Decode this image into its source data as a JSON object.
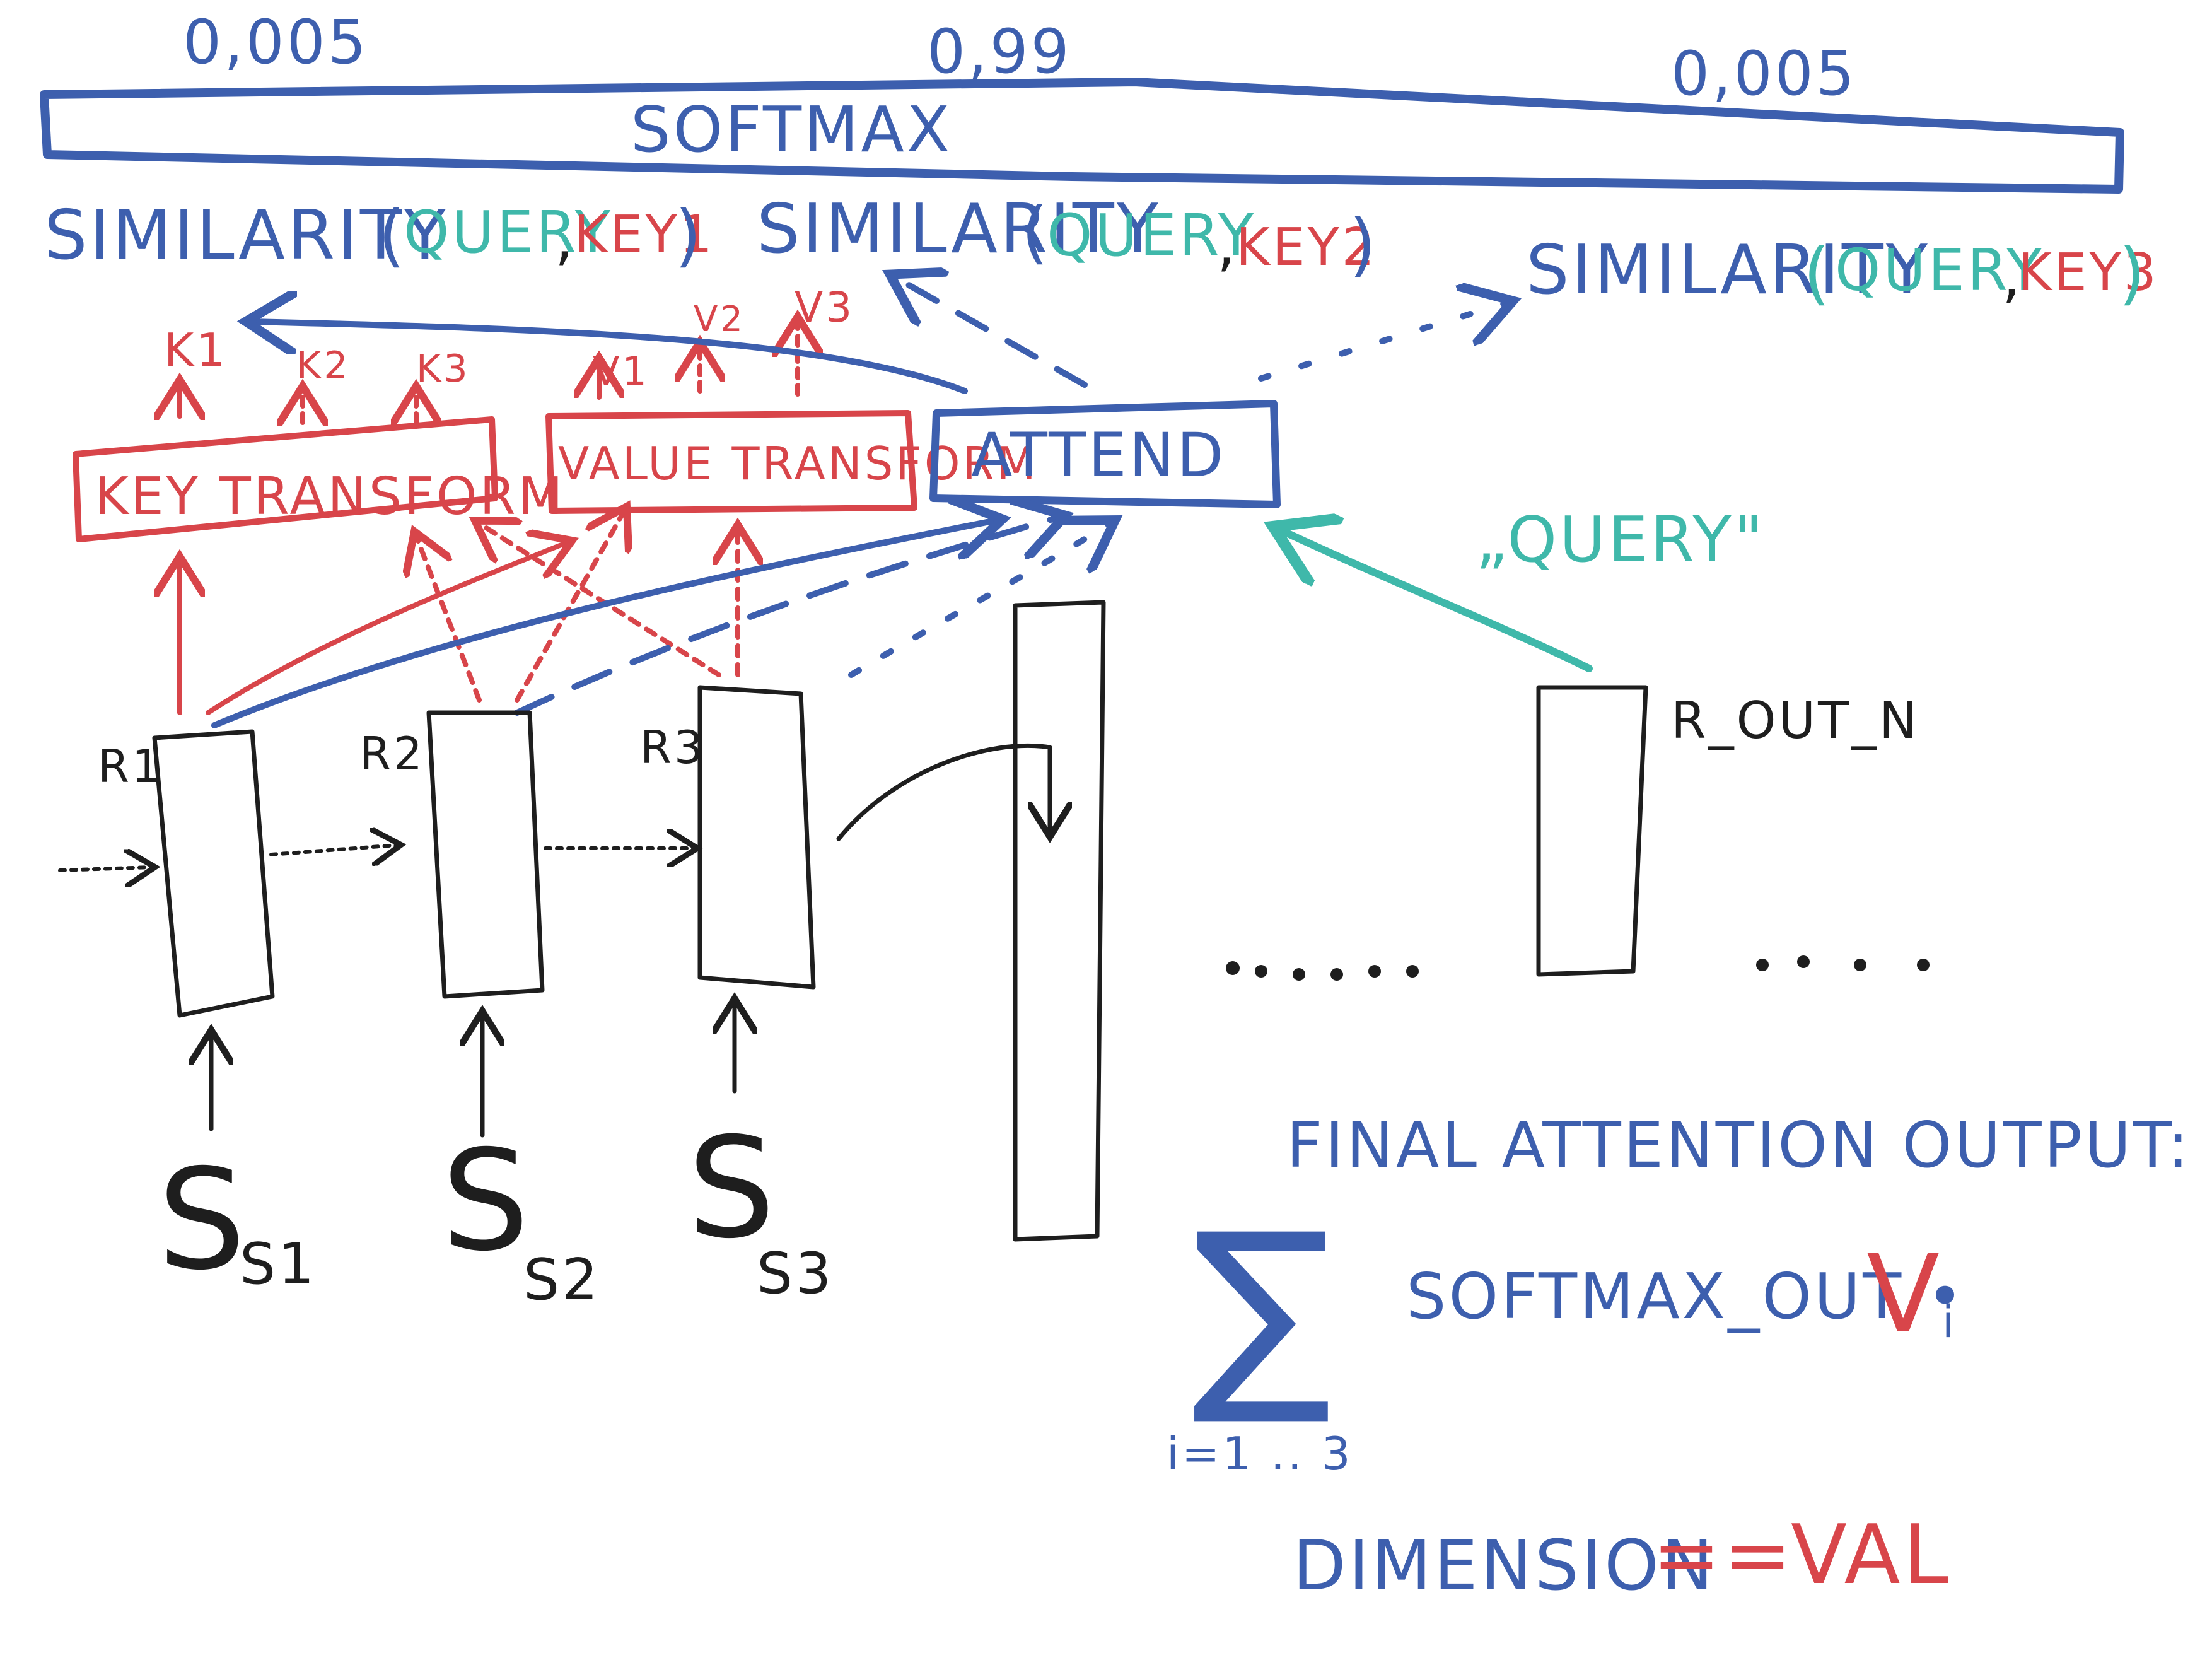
{
  "colors": {
    "blue": "#3d5fae",
    "red": "#d8454a",
    "teal": "#3fb8aa",
    "black": "#1e1e1e"
  },
  "softmax": {
    "label": "SOFTMAX",
    "weights": [
      "0,005",
      "0,99",
      "0,005"
    ]
  },
  "similarity": {
    "word": "SIMILARITY",
    "items": [
      {
        "query": "QUERY",
        "key": "KEY1"
      },
      {
        "query": "QUERY",
        "key": "KEY2"
      },
      {
        "query": "QUERY",
        "key": "KEY3"
      }
    ]
  },
  "keys": [
    "K1",
    "K2",
    "K3"
  ],
  "values": [
    "V1",
    "V2",
    "V3"
  ],
  "boxes": {
    "key_transform": "KEY TRANSFORM",
    "value_transform": "VALUE TRANSFORM",
    "attend": "ATTEND"
  },
  "query_label": "„QUERY\"",
  "rnn": {
    "hidden": [
      "R1",
      "R2",
      "R3"
    ],
    "inputs": [
      "S1",
      "S2",
      "S3"
    ],
    "output": "R_OUT_N"
  },
  "final": {
    "title": "FINAL ATTENTION OUTPUT:",
    "sum_symbol": "∑",
    "expression": "SOFTMAX_OUT •",
    "value_symbol": "V",
    "value_subscript": "i",
    "range": "i=1 .. 3",
    "dimension_label": "DIMENSION",
    "dimension_op": "==",
    "dimension_value": "VAL"
  }
}
